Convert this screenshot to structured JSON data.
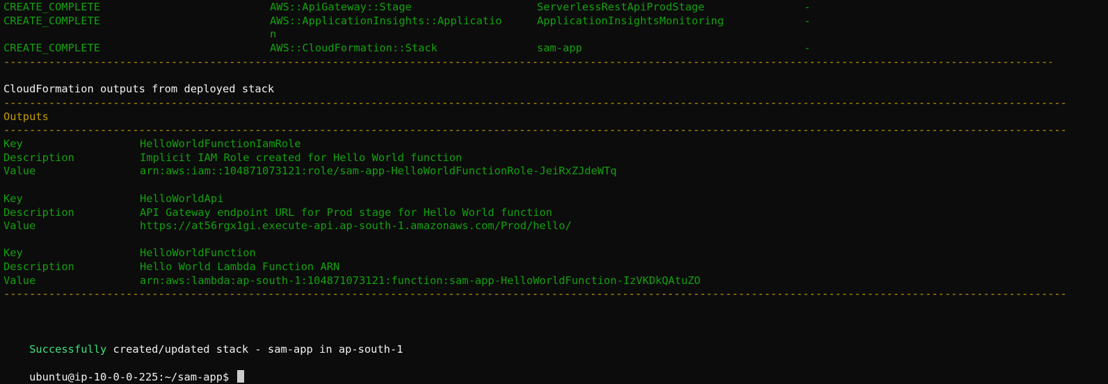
{
  "resources": [
    {
      "status": "CREATE_COMPLETE",
      "type": "AWS::ApiGateway::Stage",
      "type_cont": "",
      "logical_id": "ServerlessRestApiProdStage",
      "reason": "-"
    },
    {
      "status": "CREATE_COMPLETE",
      "type": "AWS::ApplicationInsights::Applicatio",
      "type_cont": "n",
      "logical_id": "ApplicationInsightsMonitoring",
      "reason": "-"
    },
    {
      "status": "CREATE_COMPLETE",
      "type": "AWS::CloudFormation::Stack",
      "type_cont": "",
      "logical_id": "sam-app",
      "reason": "-"
    }
  ],
  "separator_short": "--------------------------------------------------------------------------------------------------------------------------------------------------------------------------------------------------------------------------------------------------------",
  "separator_long": "--------------------------------------------------------------------------------------------------------------------------------------------------------------------------------------------------------------------------------------------------------------------",
  "outputs_heading": "CloudFormation outputs from deployed stack",
  "outputs_title": "Outputs",
  "labels": {
    "key": "Key",
    "description": "Description",
    "value": "Value"
  },
  "outputs": [
    {
      "key": "HelloWorldFunctionIamRole",
      "description": "Implicit IAM Role created for Hello World function",
      "value": "arn:aws:iam::104871073121:role/sam-app-HelloWorldFunctionRole-JeiRxZJdeWTq"
    },
    {
      "key": "HelloWorldApi",
      "description": "API Gateway endpoint URL for Prod stage for Hello World function",
      "value": "https://at56rgx1gi.execute-api.ap-south-1.amazonaws.com/Prod/hello/"
    },
    {
      "key": "HelloWorldFunction",
      "description": "Hello World Lambda Function ARN",
      "value": "arn:aws:lambda:ap-south-1:104871073121:function:sam-app-HelloWorldFunction-IzVKDkQAtuZO"
    }
  ],
  "success": {
    "word": "Successfully",
    "rest": " created/updated stack - sam-app in ap-south-1"
  },
  "prompt": "ubuntu@ip-10-0-0-225:~/sam-app$ ",
  "colors": {
    "background": "#0c0c0c",
    "green": "#16c60c",
    "yellow": "#c19c00",
    "white": "#f2f2f2"
  }
}
